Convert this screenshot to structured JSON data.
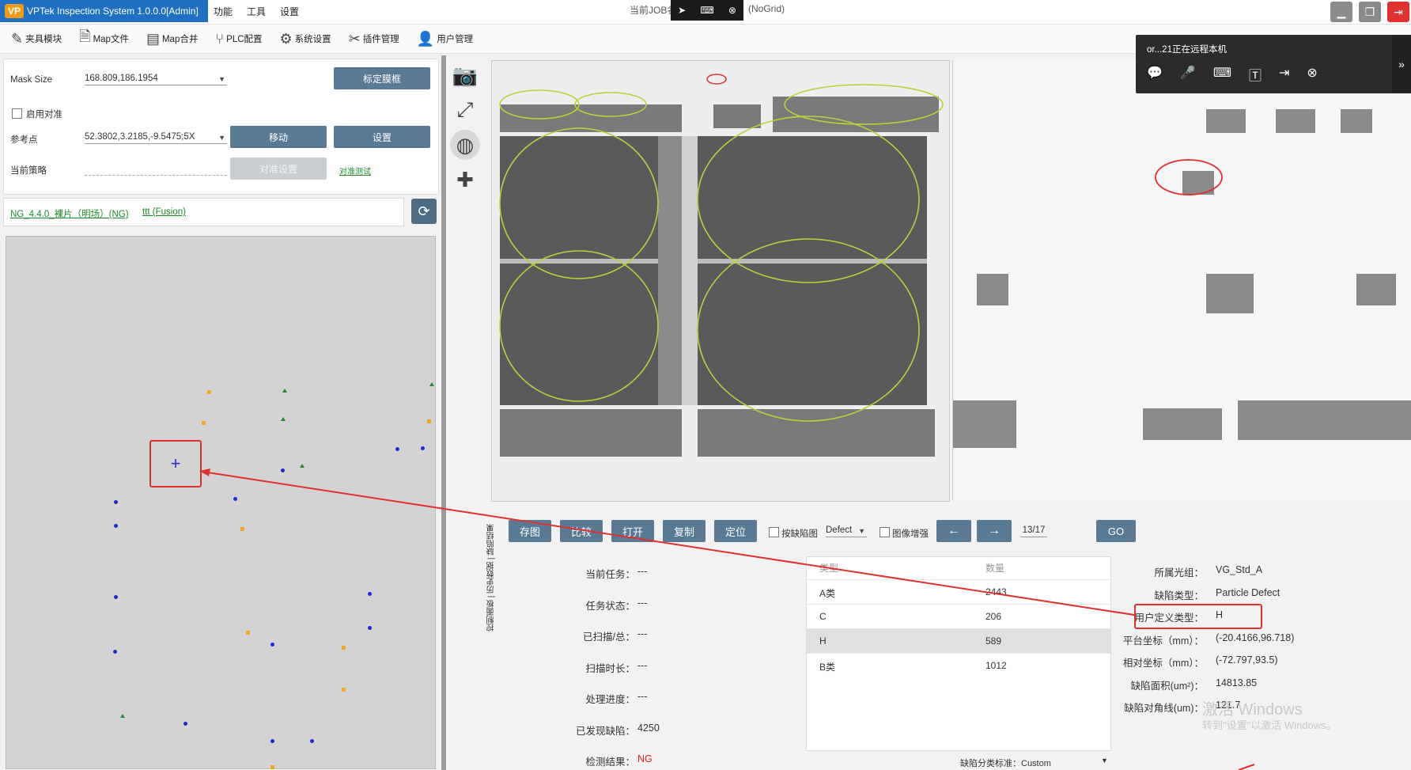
{
  "titlebar": {
    "app_title": "VPTek Inspection System 1.0.0.0[Admin]",
    "logo": "VP",
    "menu": [
      "功能",
      "工具",
      "设置"
    ],
    "job_label": "当前JOB名",
    "grid_label": "(NoGrid)"
  },
  "toolbar": {
    "items": [
      {
        "label": "夹具模块",
        "icon": "fixture-icon"
      },
      {
        "label": "Map文件",
        "icon": "file-icon"
      },
      {
        "label": "Map合并",
        "icon": "merge-icon"
      },
      {
        "label": "PLC配置",
        "icon": "plc-icon"
      },
      {
        "label": "系统设置",
        "icon": "gear-icon"
      },
      {
        "label": "插件管理",
        "icon": "tools-icon"
      },
      {
        "label": "用户管理",
        "icon": "user-icon"
      }
    ]
  },
  "settings": {
    "mask_size_label": "Mask Size",
    "mask_size_value": "168.809,186.1954",
    "calibrate_button": "标定膜框",
    "enable_align_label": "启用对准",
    "ref_point_label": "参考点",
    "ref_point_value": "52.3802,3.2185,-9.5475;5X",
    "move_button": "移动",
    "set_button": "设置",
    "strategy_label": "当前策略",
    "align_settings_button": "对准设置",
    "align_test_link": "对准测试"
  },
  "info_bar": {
    "link1": "NG_4.4.0_裸片（明场）(NG)",
    "link2": "ttt (Fusion)"
  },
  "remote": {
    "title": "or...21正在远程本机",
    "icons": [
      "chat-icon",
      "mic-icon",
      "keyboard-icon",
      "text-icon",
      "transfer-icon",
      "close-icon"
    ]
  },
  "controls": {
    "buttons": [
      "存图",
      "比较",
      "打开",
      "复制",
      "定位"
    ],
    "by_defect_label": "按缺陷图",
    "defect_select": "Defect",
    "image_enhance_label": "图像增强",
    "prev_arrow": "←",
    "next_arrow": "→",
    "page": "13/17",
    "go_button": "GO"
  },
  "vert_tabs": [
    "控制面板",
    "历史数据",
    "缺陷结果"
  ],
  "status": [
    {
      "label": "当前任务：",
      "value": "---"
    },
    {
      "label": "任务状态：",
      "value": "---"
    },
    {
      "label": "已扫描/总：",
      "value": "---"
    },
    {
      "label": "扫描时长：",
      "value": "---"
    },
    {
      "label": "处理进度：",
      "value": "---"
    },
    {
      "label": "已发现缺陷：",
      "value": "4250"
    },
    {
      "label": "检测结果：",
      "value": "NG"
    }
  ],
  "result_color": "#e02020",
  "table": {
    "headers": [
      "类型",
      "数量"
    ],
    "rows": [
      {
        "type": "A类",
        "count": "2443"
      },
      {
        "type": "C",
        "count": "206"
      },
      {
        "type": "H",
        "count": "589"
      },
      {
        "type": "B类",
        "count": "1012"
      }
    ],
    "footer_label": "缺陷分类标准：Custom"
  },
  "details": [
    {
      "label": "所属光组：",
      "value": "VG_Std_A"
    },
    {
      "label": "缺陷类型：",
      "value": "Particle Defect"
    },
    {
      "label": "用户定义类型：",
      "value": "H"
    },
    {
      "label": "平台坐标（mm）：",
      "value": "(-20.4166,96.718)"
    },
    {
      "label": "相对坐标（mm）：",
      "value": "(-72.797,93.5)"
    },
    {
      "label": "缺陷面积(um²)：",
      "value": "14813.85"
    },
    {
      "label": "缺陷对角线(um)：",
      "value": "121.7"
    }
  ],
  "watermark": {
    "line1": "激活 Windows",
    "line2": "转到\"设置\"以激活 Windows。"
  },
  "colors": {
    "title_blue": "#1f6fc2",
    "button_steel": "#5a7a94",
    "annotation_red": "#e03030",
    "contour_green": "#b8d23a"
  }
}
